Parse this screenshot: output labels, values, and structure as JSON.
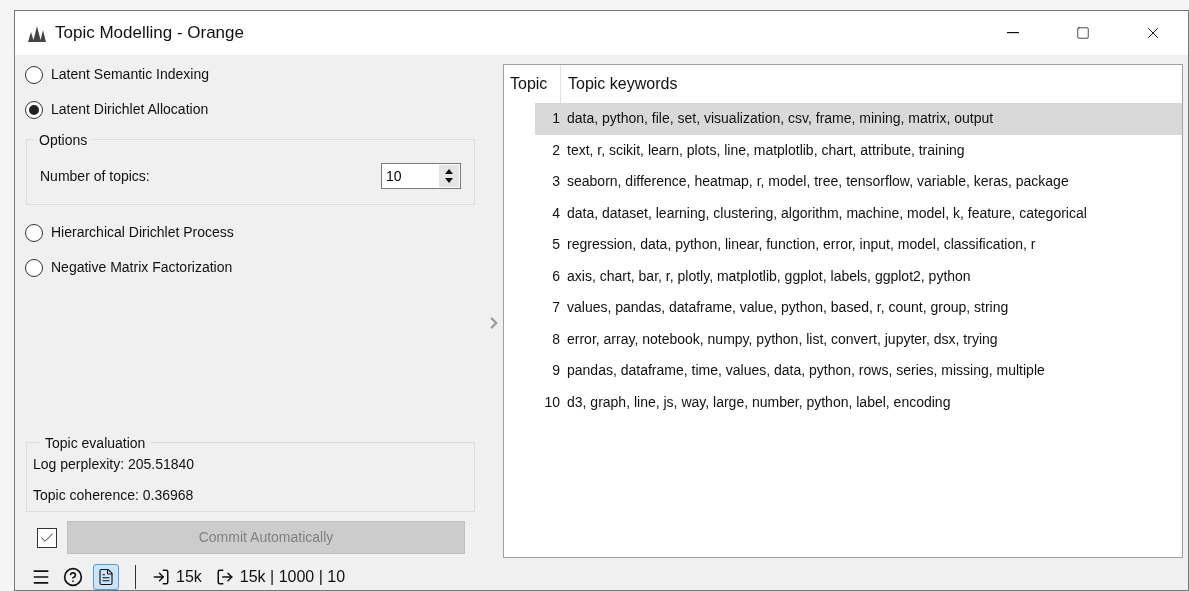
{
  "window": {
    "title": "Topic Modelling - Orange"
  },
  "methods": [
    {
      "label": "Latent Semantic Indexing",
      "selected": false
    },
    {
      "label": "Latent Dirichlet Allocation",
      "selected": true
    },
    {
      "label": "Hierarchical Dirichlet Process",
      "selected": false
    },
    {
      "label": "Negative Matrix Factorization",
      "selected": false
    }
  ],
  "options": {
    "title": "Options",
    "label": "Number of topics:",
    "value": "10"
  },
  "evaluation": {
    "title": "Topic evaluation",
    "lines": [
      "Log perplexity: 205.51840",
      "Topic coherence: 0.36968"
    ]
  },
  "commit": {
    "checked": true,
    "label": "Commit Automatically",
    "disabled": true
  },
  "table": {
    "columns": [
      "Topic",
      "Topic keywords"
    ],
    "rows": [
      {
        "topic": "1",
        "keywords": "data, python, file, set, visualization, csv, frame, mining, matrix, output",
        "selected": true
      },
      {
        "topic": "2",
        "keywords": "text, r, scikit, learn, plots, line, matplotlib, chart, attribute, training",
        "selected": false
      },
      {
        "topic": "3",
        "keywords": "seaborn, difference, heatmap, r, model, tree, tensorflow, variable, keras, package",
        "selected": false
      },
      {
        "topic": "4",
        "keywords": "data, dataset, learning, clustering, algorithm, machine, model, k, feature, categorical",
        "selected": false
      },
      {
        "topic": "5",
        "keywords": "regression, data, python, linear, function, error, input, model, classification, r",
        "selected": false
      },
      {
        "topic": "6",
        "keywords": "axis, chart, bar, r, plotly, matplotlib, ggplot, labels, ggplot2, python",
        "selected": false
      },
      {
        "topic": "7",
        "keywords": "values, pandas, dataframe, value, python, based, r, count, group, string",
        "selected": false
      },
      {
        "topic": "8",
        "keywords": "error, array, notebook, numpy, python, list, convert, jupyter, dsx, trying",
        "selected": false
      },
      {
        "topic": "9",
        "keywords": "pandas, dataframe, time, values, data, python, rows, series, missing, multiple",
        "selected": false
      },
      {
        "topic": "10",
        "keywords": "d3, graph, line, js, way, large, number, python, label, encoding",
        "selected": false
      }
    ]
  },
  "status_bar": {
    "report_active": true,
    "input": "15k",
    "output": "15k | 1000 | 10"
  }
}
